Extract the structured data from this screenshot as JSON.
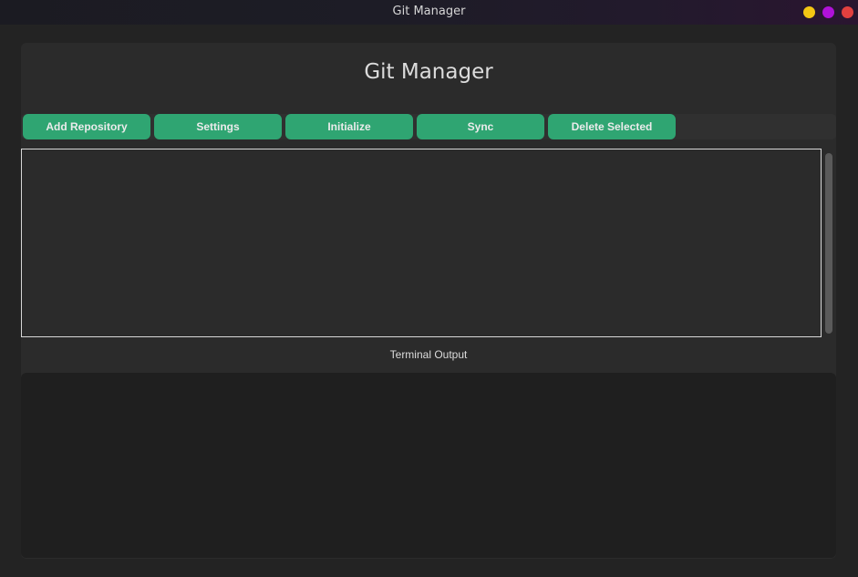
{
  "window": {
    "title": "Git Manager"
  },
  "app": {
    "title": "Git Manager"
  },
  "toolbar": {
    "buttons": [
      {
        "label": "Add Repository"
      },
      {
        "label": "Settings"
      },
      {
        "label": "Initialize"
      },
      {
        "label": "Sync"
      },
      {
        "label": "Delete Selected"
      }
    ]
  },
  "repositories": {
    "items": []
  },
  "terminal": {
    "label": "Terminal Output",
    "content": ""
  },
  "colors": {
    "accent": "#2fa572",
    "background": "#2b2b2b",
    "terminal_background": "#1f1f1f",
    "minimize": "#f3c613",
    "maximize": "#b012d8",
    "close": "#e2403f"
  }
}
